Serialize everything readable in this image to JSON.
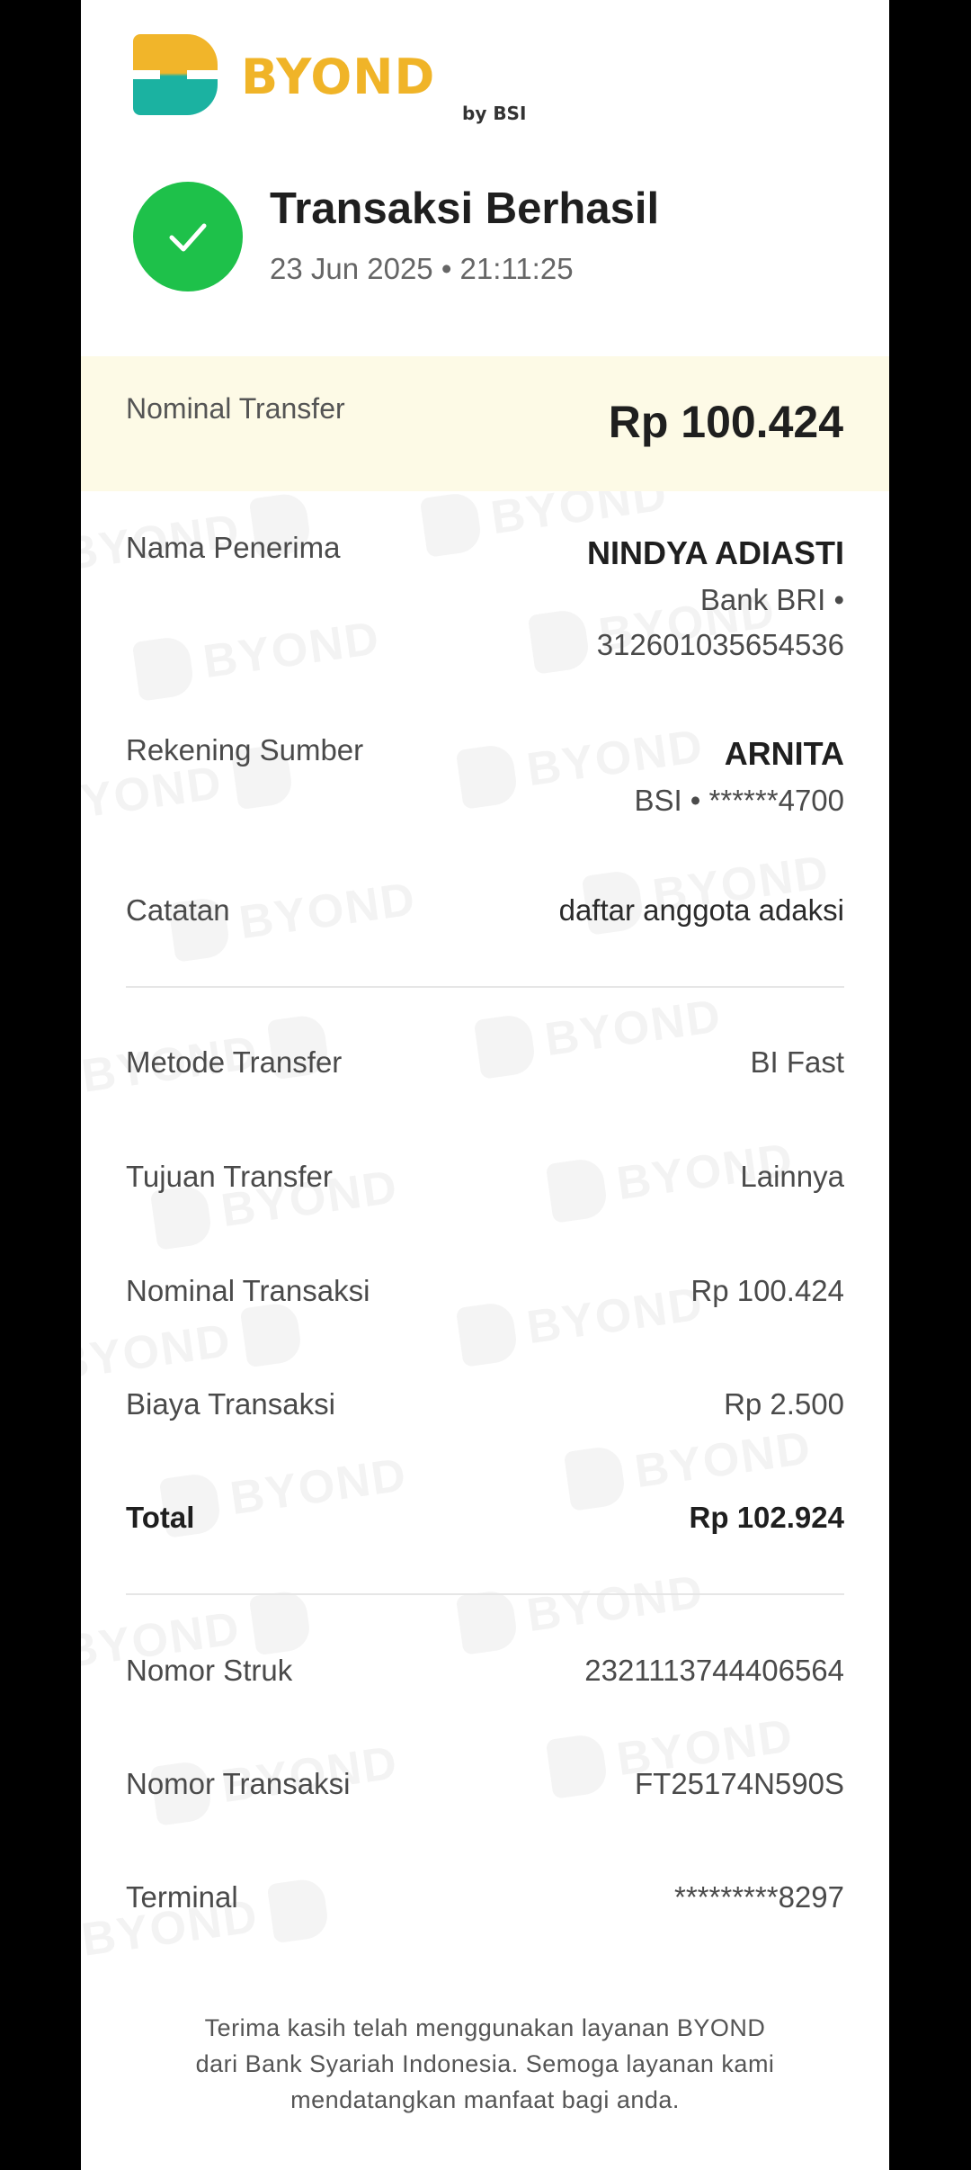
{
  "brand": {
    "logo_text": "BYOND",
    "logo_sub": "by BSI"
  },
  "status": {
    "title": "Transaksi Berhasil",
    "datetime": "23 Jun 2025 • 21:11:25",
    "color": "#1ec14a"
  },
  "nominal_transfer": {
    "label": "Nominal Transfer",
    "value": "Rp 100.424"
  },
  "recipient": {
    "label": "Nama Penerima",
    "name": "NINDYA ADIASTI",
    "bank": "Bank BRI •",
    "account": "312601035654536"
  },
  "source": {
    "label": "Rekening Sumber",
    "name": "ARNITA",
    "account": "BSI • ******4700"
  },
  "note": {
    "label": "Catatan",
    "value": "daftar anggota adaksi"
  },
  "details": [
    {
      "label": "Metode Transfer",
      "value": "BI Fast"
    },
    {
      "label": "Tujuan Transfer",
      "value": "Lainnya"
    },
    {
      "label": "Nominal Transaksi",
      "value": "Rp 100.424"
    },
    {
      "label": "Biaya Transaksi",
      "value": "Rp 2.500"
    }
  ],
  "total": {
    "label": "Total",
    "value": "Rp 102.924"
  },
  "references": [
    {
      "label": "Nomor Struk",
      "value": "2321113744406564"
    },
    {
      "label": "Nomor Transaksi",
      "value": "FT25174N590S"
    },
    {
      "label": "Terminal",
      "value": "*********8297"
    }
  ],
  "footer": {
    "line1": "Terima kasih telah menggunakan layanan BYOND",
    "line2": "dari Bank Syariah Indonesia. Semoga layanan kami",
    "line3": "mendatangkan manfaat bagi anda."
  },
  "colors": {
    "accent_yellow": "#f0b428",
    "accent_teal": "#1bb2a1",
    "band": "#fdfae6"
  }
}
